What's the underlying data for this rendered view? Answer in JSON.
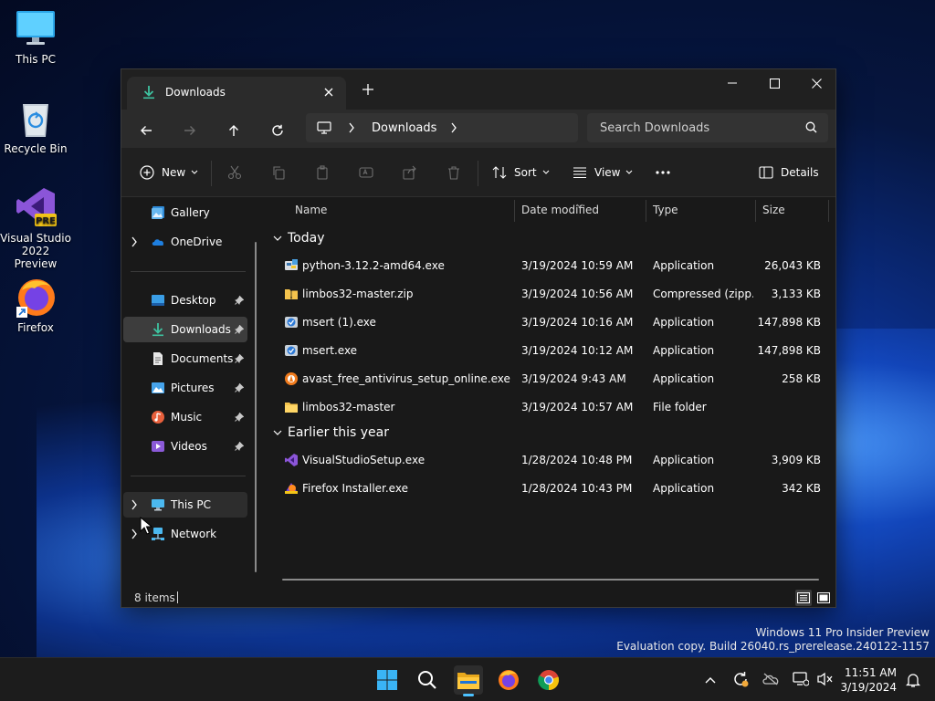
{
  "desktop": {
    "icons": [
      {
        "label": "This PC",
        "icon": "monitor-icon"
      },
      {
        "label": "Recycle Bin",
        "icon": "recycle-bin-icon"
      },
      {
        "label": "Visual Studio 2022 Preview",
        "icon": "visual-studio-icon",
        "badge": "PRE"
      },
      {
        "label": "Firefox",
        "icon": "firefox-icon"
      }
    ],
    "watermark": {
      "line1": "Windows 11 Pro Insider Preview",
      "line2": "Evaluation copy. Build 26040.rs_prerelease.240122-1157"
    }
  },
  "window": {
    "tab_title": "Downloads",
    "tab_icon": "download-icon",
    "address": {
      "crumb": "Downloads"
    },
    "search": {
      "placeholder": "Search Downloads"
    },
    "toolbar": {
      "new_label": "New",
      "sort_label": "Sort",
      "view_label": "View",
      "details_label": "Details"
    },
    "sidebar": {
      "items": [
        {
          "label": "Gallery",
          "icon": "gallery-icon"
        },
        {
          "label": "OneDrive",
          "icon": "onedrive-icon"
        },
        {
          "label": "Desktop",
          "icon": "desktop-icon",
          "pinned": true
        },
        {
          "label": "Downloads",
          "icon": "download-icon",
          "pinned": true,
          "selected": true
        },
        {
          "label": "Documents",
          "icon": "documents-icon",
          "pinned": true
        },
        {
          "label": "Pictures",
          "icon": "pictures-icon",
          "pinned": true
        },
        {
          "label": "Music",
          "icon": "music-icon",
          "pinned": true
        },
        {
          "label": "Videos",
          "icon": "videos-icon",
          "pinned": true
        },
        {
          "label": "This PC",
          "icon": "monitor-icon",
          "hovered": true
        },
        {
          "label": "Network",
          "icon": "network-icon"
        }
      ]
    },
    "columns": {
      "name": "Name",
      "date": "Date modified",
      "type": "Type",
      "size": "Size"
    },
    "groups": [
      {
        "label": "Today",
        "files": [
          {
            "name": "python-3.12.2-amd64.exe",
            "date": "3/19/2024 10:59 AM",
            "type": "Application",
            "size": "26,043 KB",
            "icon": "python-installer-icon"
          },
          {
            "name": "limbos32-master.zip",
            "date": "3/19/2024 10:56 AM",
            "type": "Compressed (zipp...",
            "size": "3,133 KB",
            "icon": "zip-folder-icon"
          },
          {
            "name": "msert (1).exe",
            "date": "3/19/2024 10:16 AM",
            "type": "Application",
            "size": "147,898 KB",
            "icon": "msert-icon"
          },
          {
            "name": "msert.exe",
            "date": "3/19/2024 10:12 AM",
            "type": "Application",
            "size": "147,898 KB",
            "icon": "msert-icon"
          },
          {
            "name": "avast_free_antivirus_setup_online.exe",
            "date": "3/19/2024 9:43 AM",
            "type": "Application",
            "size": "258 KB",
            "icon": "avast-icon"
          },
          {
            "name": "limbos32-master",
            "date": "3/19/2024 10:57 AM",
            "type": "File folder",
            "size": "",
            "icon": "folder-icon"
          }
        ]
      },
      {
        "label": "Earlier this year",
        "files": [
          {
            "name": "VisualStudioSetup.exe",
            "date": "1/28/2024 10:48 PM",
            "type": "Application",
            "size": "3,909 KB",
            "icon": "visual-studio-icon"
          },
          {
            "name": "Firefox Installer.exe",
            "date": "1/28/2024 10:43 PM",
            "type": "Application",
            "size": "342 KB",
            "icon": "firefox-installer-icon"
          }
        ]
      }
    ],
    "status": {
      "count": "8 items"
    }
  },
  "taskbar": {
    "clock_time": "11:51 AM",
    "clock_date": "3/19/2024"
  },
  "colors": {
    "accent": "#4cc2ff",
    "window_bg": "#191919",
    "taskbar_bg": "#1c1c1c"
  }
}
